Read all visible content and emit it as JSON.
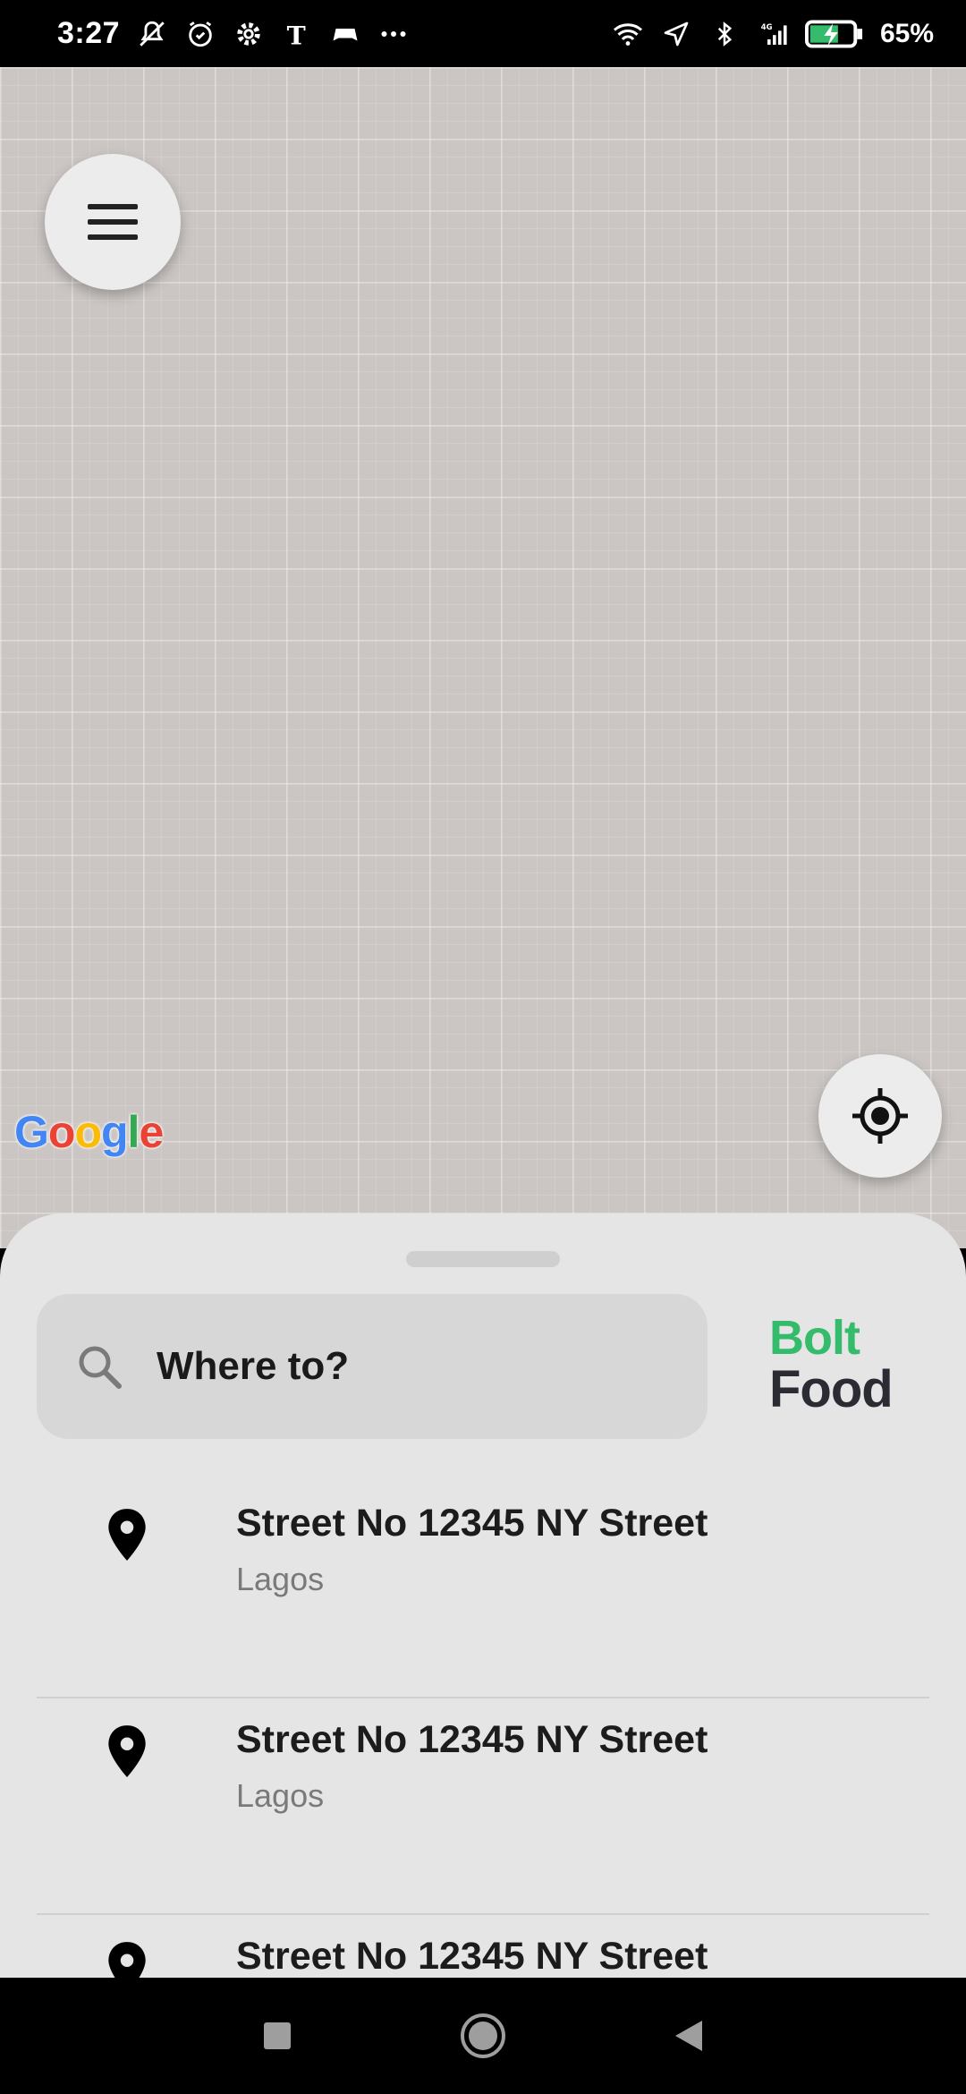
{
  "status_bar": {
    "time": "3:27",
    "battery_percent": "65%",
    "network": "4G",
    "icons_left": [
      "mute-icon",
      "alarm-icon",
      "settings-icon",
      "nytimes-icon",
      "game-icon",
      "more-icon"
    ],
    "icons_right": [
      "wifi-icon",
      "location-icon",
      "bluetooth-icon",
      "signal-icon",
      "battery-icon"
    ]
  },
  "map": {
    "attribution": "Google",
    "menu_icon": "hamburger-icon",
    "locate_icon": "my-location-icon"
  },
  "sheet": {
    "search_placeholder": "Where to?",
    "brand_line1": "Bolt",
    "brand_line2": "Food",
    "brand_color": "#34bb6b",
    "recent_places": [
      {
        "title": "Street No 12345 NY Street",
        "subtitle": "Lagos"
      },
      {
        "title": "Street No 12345 NY Street",
        "subtitle": "Lagos"
      },
      {
        "title": "Street No 12345 NY Street",
        "subtitle": ""
      }
    ]
  },
  "nav_bar": {
    "buttons": [
      "recents-icon",
      "home-icon",
      "back-icon"
    ]
  }
}
